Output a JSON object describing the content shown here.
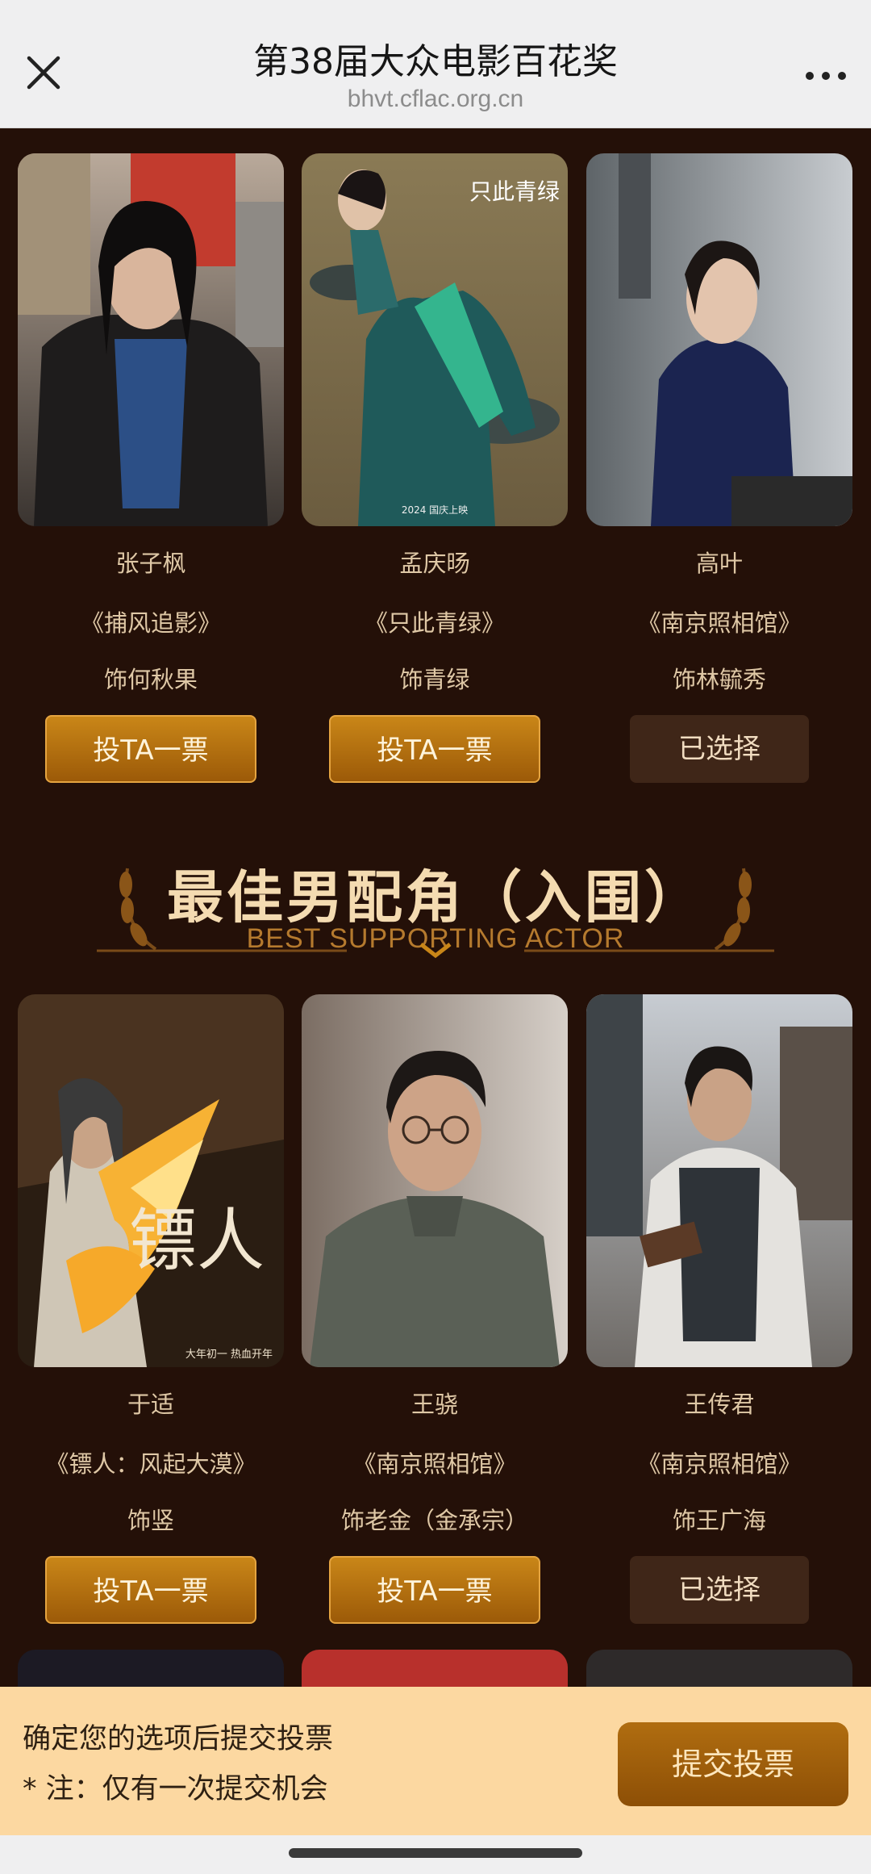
{
  "header": {
    "title": "第38届大众电影百花奖",
    "url": "bhvt.cflac.org.cn",
    "close_icon": "close-icon",
    "more_icon": "more-icon"
  },
  "section_top": {
    "nominees": [
      {
        "name": "张子枫",
        "film": "《捕风追影》",
        "role": "饰何秋果",
        "button": "投TA一票",
        "selected": false
      },
      {
        "name": "孟庆旸",
        "film": "《只此青绿》",
        "role": "饰青绿",
        "button": "投TA一票",
        "selected": false,
        "poster_text": "只此青绿",
        "poster_caption": "2024 国庆上映"
      },
      {
        "name": "高叶",
        "film": "《南京照相馆》",
        "role": "饰林毓秀",
        "button": "已选择",
        "selected": true
      }
    ]
  },
  "section_supporting_actor": {
    "title": "最佳男配角（入围）",
    "subtitle": "BEST SUPPORTING ACTOR",
    "nominees": [
      {
        "name": "于适",
        "film": "《镖人：风起大漠》",
        "role": "饰竖",
        "button": "投TA一票",
        "selected": false,
        "poster_text": "镖人",
        "poster_caption": "大年初一 热血开年"
      },
      {
        "name": "王骁",
        "film": "《南京照相馆》",
        "role": "饰老金（金承宗）",
        "button": "投TA一票",
        "selected": false
      },
      {
        "name": "王传君",
        "film": "《南京照相馆》",
        "role": "饰王广海",
        "button": "已选择",
        "selected": true
      }
    ]
  },
  "bottom_bar": {
    "line1": "确定您的选项后提交投票",
    "line2": "* 注：仅有一次提交机会",
    "submit": "提交投票"
  },
  "colors": {
    "background": "#241008",
    "accent": "#c98618",
    "selected": "#3f2618",
    "text": "#dfc8a6",
    "bottom_bar": "#fcd8a1"
  }
}
